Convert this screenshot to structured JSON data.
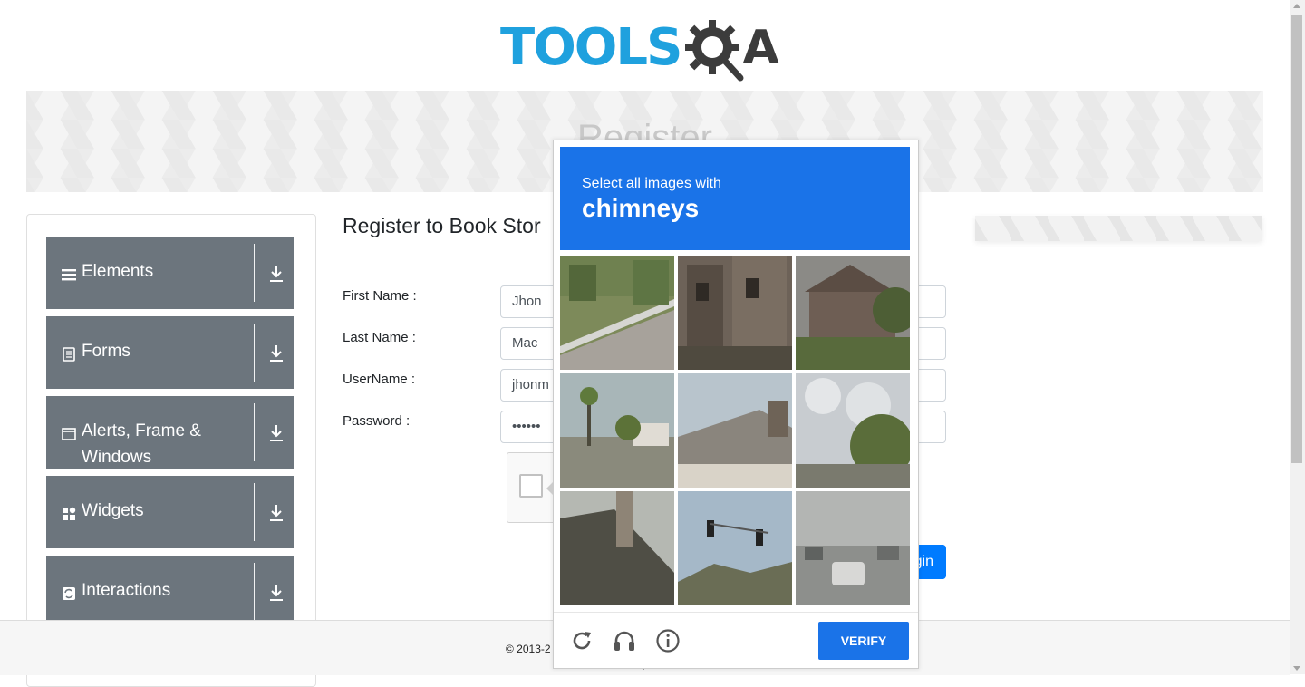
{
  "logo": {
    "text_part": "TOOLS",
    "letter_a": "A"
  },
  "banner": {
    "title": "Register"
  },
  "sidebar": {
    "groups": [
      {
        "label": "Elements",
        "icon": "hamburger-icon"
      },
      {
        "label": "Forms",
        "icon": "document-icon"
      },
      {
        "label": "Alerts, Frame & Windows",
        "icon": "window-icon"
      },
      {
        "label": "Widgets",
        "icon": "widgets-icon"
      },
      {
        "label": "Interactions",
        "icon": "interactions-icon"
      }
    ]
  },
  "form": {
    "title": "Register to Book Stor",
    "first_name_label": "First Name :",
    "first_name_value": "Jhon",
    "last_name_label": "Last Name :",
    "last_name_value": "Mac",
    "username_label": "UserName :",
    "username_value": "jhonm",
    "password_label": "Password :",
    "password_value": "••••••",
    "login_label": "gin"
  },
  "footer": {
    "copyright": "© 2013-2"
  },
  "challenge": {
    "instruction": "Select all images with",
    "target": "chimneys",
    "verify_label": "VERIFY",
    "tiles": [
      "road-with-guardrail",
      "brick-building",
      "house-behind-trees",
      "street-with-palm-trees",
      "roof-with-chimney",
      "trees-and-sky",
      "roof-with-chimney-dark",
      "traffic-lights",
      "highway-with-cars"
    ]
  },
  "colors": {
    "brand_blue": "#1fa1de",
    "recaptcha_blue": "#1a73e8",
    "sidebar_gray": "#6c757d",
    "button_blue": "#007bff"
  }
}
